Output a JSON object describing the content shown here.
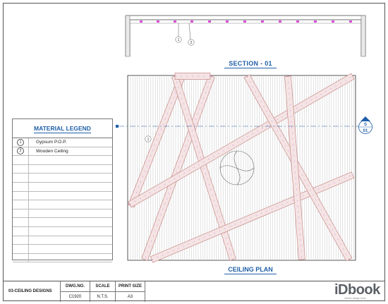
{
  "section": {
    "title": "SECTION - 01",
    "callout_1": "1",
    "callout_2": "2"
  },
  "plan": {
    "title": "CEILING PLAN",
    "callout_1": "1",
    "section_marker_top": "S",
    "section_marker_bottom": "01"
  },
  "legend": {
    "title": "MATERIAL LEGEND",
    "items": [
      {
        "num": "1",
        "label": "Gypsum P.O.P."
      },
      {
        "num": "2",
        "label": "Wooden Ceiling"
      },
      {
        "num": "",
        "label": ""
      },
      {
        "num": "",
        "label": ""
      },
      {
        "num": "",
        "label": ""
      },
      {
        "num": "",
        "label": ""
      },
      {
        "num": "",
        "label": ""
      },
      {
        "num": "",
        "label": ""
      },
      {
        "num": "",
        "label": ""
      },
      {
        "num": "",
        "label": ""
      },
      {
        "num": "",
        "label": ""
      },
      {
        "num": "",
        "label": ""
      },
      {
        "num": "",
        "label": ""
      },
      {
        "num": "",
        "label": ""
      }
    ]
  },
  "titleblock": {
    "drawing_name": "03-CEILING DESIGNS",
    "dwg_no_label": "DWG.NO.",
    "dwg_no_value": "C1920",
    "scale_label": "SCALE",
    "scale_value": "N.T.S.",
    "print_label": "PRINT SIZE",
    "print_value": "A3"
  },
  "brand": {
    "name": "iDbook",
    "tagline": "interior design book"
  },
  "colors": {
    "accent": "#1f5fa8",
    "beam": "#c88a8a",
    "light": "#d94fd4",
    "line": "#444444"
  }
}
